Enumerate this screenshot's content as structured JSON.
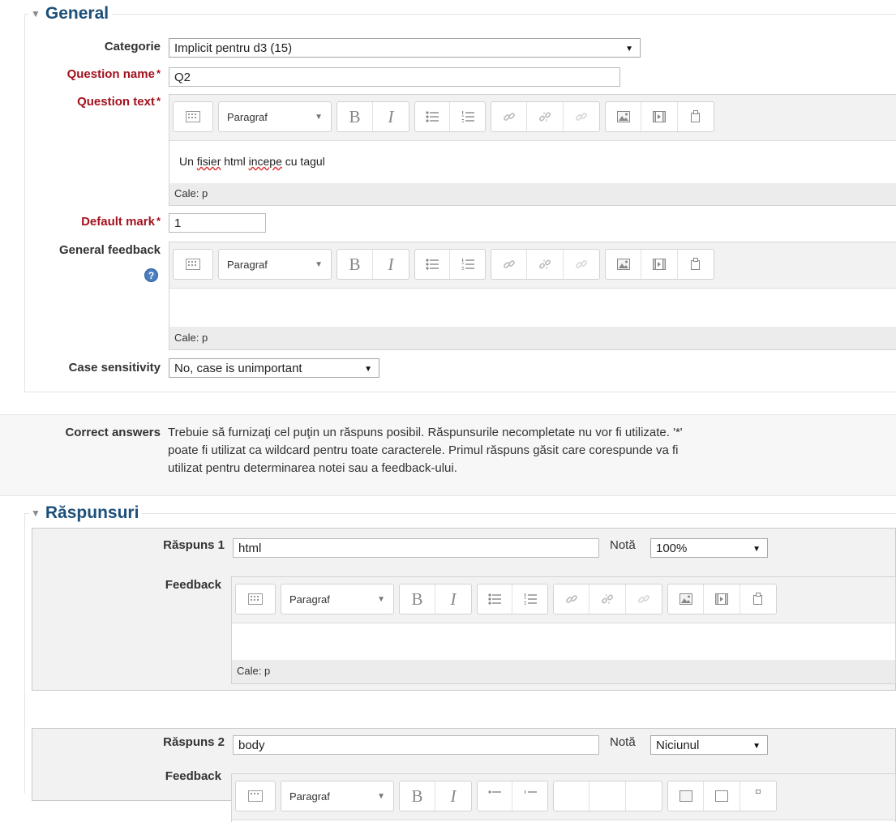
{
  "general": {
    "legend": "General",
    "category": {
      "label": "Categorie",
      "value": "Implicit pentru d3 (15)"
    },
    "question_name": {
      "label": "Question name",
      "value": "Q2"
    },
    "question_text": {
      "label": "Question text",
      "format": "Paragraf",
      "content_words": [
        "Un",
        "fisier",
        "html",
        "incepe",
        "cu tagul"
      ],
      "path": "Cale: p"
    },
    "default_mark": {
      "label": "Default mark",
      "value": "1"
    },
    "general_feedback": {
      "label": "General feedback",
      "format": "Paragraf",
      "content": "",
      "path": "Cale: p"
    },
    "case_sensitivity": {
      "label": "Case sensitivity",
      "value": "No, case is unimportant"
    }
  },
  "correct_answers": {
    "label": "Correct answers",
    "lines": [
      "Trebuie să furnizaţi cel puţin un răspuns posibil. Răspunsurile necompletate nu vor fi utilizate. '*'",
      "poate fi utilizat ca wildcard pentru toate caracterele. Primul răspuns găsit care corespunde va fi",
      "utilizat pentru determinarea notei sau a feedback-ului."
    ]
  },
  "answers": {
    "legend": "Răspunsuri",
    "items": [
      {
        "label": "Răspuns 1",
        "value": "html",
        "grade_label": "Notă",
        "grade": "100%",
        "feedback_label": "Feedback",
        "format": "Paragraf",
        "path": "Cale: p"
      },
      {
        "label": "Răspuns 2",
        "value": "body",
        "grade_label": "Notă",
        "grade": "Niciunul",
        "feedback_label": "Feedback",
        "format": "Paragraf",
        "path": ""
      }
    ]
  },
  "required_marker": "*",
  "help_glyph": "?",
  "toolbar": {
    "bold": "B",
    "italic": "I",
    "buttons": [
      "toggle-toolbar-icon",
      "bold-icon",
      "italic-icon",
      "unordered-list-icon",
      "ordered-list-icon",
      "link-icon",
      "unlink-icon",
      "anchor-icon",
      "image-icon",
      "media-icon",
      "manage-files-icon"
    ]
  },
  "colors": {
    "legend": "#1c4f79",
    "required": "#a3111e",
    "panel": "#f2f2f2",
    "help": "#4a7ebf"
  }
}
